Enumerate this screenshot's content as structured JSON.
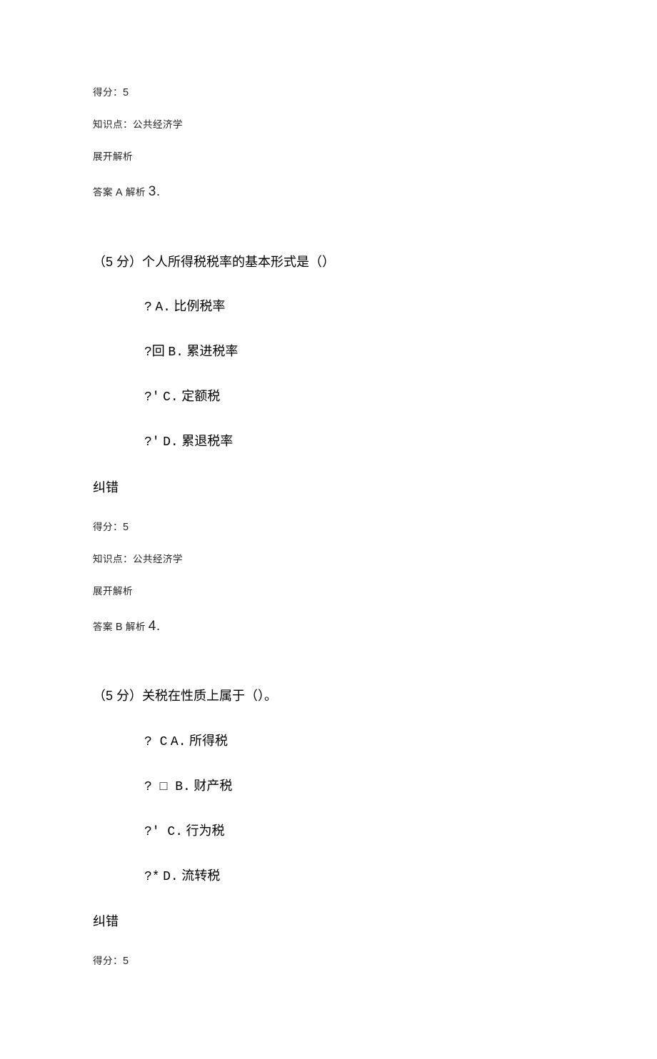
{
  "q2_tail": {
    "score_label": "得分：",
    "score_value": "5",
    "knowledge_label": "知识点：",
    "knowledge_value": "公共经济学",
    "expand_label": "展开解析",
    "answer_prefix": "答案",
    "answer_letter": "A",
    "answer_suffix": "解析",
    "next_qnum": "3."
  },
  "q3": {
    "points_label": "（5 分）",
    "stem": "个人所得税税率的基本形式是（）",
    "options": [
      {
        "marker": "?",
        "letter": "A.",
        "text": "比例税率"
      },
      {
        "marker": "?回",
        "letter": "B.",
        "text": "累进税率"
      },
      {
        "marker": "?'",
        "letter": "C.",
        "text": "定额税"
      },
      {
        "marker": "?'",
        "letter": "D.",
        "text": "累退税率"
      }
    ],
    "correct_link": "纠错",
    "score_label": "得分：",
    "score_value": "5",
    "knowledge_label": "知识点：",
    "knowledge_value": "公共经济学",
    "expand_label": "展开解析",
    "answer_prefix": "答案",
    "answer_letter": "B",
    "answer_suffix": "解析",
    "next_qnum": "4."
  },
  "q4": {
    "points_label": "（5 分）",
    "stem": "关税在性质上属于（）。",
    "options": [
      {
        "marker": "? C",
        "letter": "A.",
        "text": "所得税"
      },
      {
        "marker": "? □ ",
        "letter": "B.",
        "text": "财产税"
      },
      {
        "marker": "?' ",
        "letter": "C.",
        "text": "行为税"
      },
      {
        "marker": "?*",
        "letter": "D.",
        "text": "流转税"
      }
    ],
    "correct_link": "纠错",
    "score_label": "得分：",
    "score_value": "5"
  }
}
